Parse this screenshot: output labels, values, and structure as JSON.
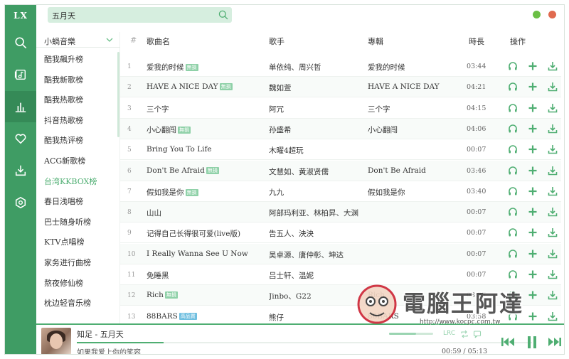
{
  "app": {
    "logo": "LX"
  },
  "colors": {
    "brand_green": "#3f9c64",
    "accent_green": "#4fae72",
    "min_dot": "#6bbf45",
    "close_dot": "#e06a4f"
  },
  "search": {
    "value": "五月天",
    "icon": "search-icon"
  },
  "nav": [
    {
      "icon": "search-icon",
      "active": false
    },
    {
      "icon": "music-list-icon",
      "active": false
    },
    {
      "icon": "leaderboard-icon",
      "active": true
    },
    {
      "icon": "heart-icon",
      "active": false
    },
    {
      "icon": "download-icon",
      "active": false
    },
    {
      "icon": "settings-icon",
      "active": false
    }
  ],
  "sidebar": {
    "source": "小蝸音樂",
    "items": [
      {
        "label": "酷我飆升榜"
      },
      {
        "label": "酷我新歌榜"
      },
      {
        "label": "酷我热歌榜"
      },
      {
        "label": "抖音热歌榜"
      },
      {
        "label": "酷我热评榜"
      },
      {
        "label": "ACG新歌榜"
      },
      {
        "label": "台湾KKBOX榜",
        "active": true
      },
      {
        "label": "春日浅唱榜"
      },
      {
        "label": "巴士随身听榜"
      },
      {
        "label": "KTV点唱榜"
      },
      {
        "label": "家务进行曲榜"
      },
      {
        "label": "熬夜修仙榜"
      },
      {
        "label": "枕边轻音乐榜"
      }
    ]
  },
  "table": {
    "headers": {
      "num": "#",
      "name": "歌曲名",
      "artist": "歌手",
      "album": "專輯",
      "duration": "時長",
      "actions": "操作"
    },
    "rows": [
      {
        "num": "1",
        "name": "爱我的时候",
        "badge": "無損",
        "artist": "单依纯、周兴哲",
        "album": "爱我的时候",
        "duration": "03:44"
      },
      {
        "num": "2",
        "name": "HAVE A NICE DAY",
        "badge": "無損",
        "artist": "魏如萱",
        "album": "HAVE A NICE DAY",
        "duration": "04:21"
      },
      {
        "num": "3",
        "name": "三个字",
        "badge": "",
        "artist": "阿冗",
        "album": "三个字",
        "duration": "04:15"
      },
      {
        "num": "4",
        "name": "小心翻闯",
        "badge": "無損",
        "artist": "孙盛希",
        "album": "小心翻闯",
        "duration": "04:06"
      },
      {
        "num": "5",
        "name": "Bring You To Life",
        "badge": "",
        "artist": "木曜4超玩",
        "album": "",
        "duration": "00:07"
      },
      {
        "num": "6",
        "name": "Don't Be Afraid",
        "badge": "無損",
        "artist": "文慧如、黄淑贤儒",
        "album": "Don't Be Afraid",
        "duration": "03:46"
      },
      {
        "num": "7",
        "name": "假如我是你",
        "badge": "無損",
        "artist": "九九",
        "album": "假如我是你",
        "duration": "03:40"
      },
      {
        "num": "8",
        "name": "山山",
        "badge": "",
        "artist": "阿部玛利亚、林柏昇、大渊",
        "album": "",
        "duration": "00:07"
      },
      {
        "num": "9",
        "name": "记得自己长得很可爱(live版)",
        "badge": "",
        "artist": "告五人、泱泱",
        "album": "",
        "duration": "00:07"
      },
      {
        "num": "10",
        "name": "I Really Wanna See U Now",
        "badge": "",
        "artist": "吴卓源、唐仲彰、坤达",
        "album": "",
        "duration": "00:07"
      },
      {
        "num": "11",
        "name": "免睡黑",
        "badge": "",
        "artist": "吕士轩、温妮",
        "album": "",
        "duration": "00:07"
      },
      {
        "num": "12",
        "name": "Rich",
        "badge": "無損",
        "artist": "Jinbo、G22",
        "album": "Rich",
        "duration": "03:27"
      },
      {
        "num": "13",
        "name": "88BARS",
        "badge": "高品質",
        "badge_type": "hq",
        "artist": "熊仔",
        "album": "88BARS",
        "duration": "03:58"
      }
    ]
  },
  "player": {
    "title": "知足 - 五月天",
    "lyric": "如果我爱上你的笑容",
    "current": "00:59",
    "separator": "/",
    "total": "05:13",
    "progress": 0.19,
    "volume": 0.62,
    "lrc_label": "LRC"
  },
  "watermark": {
    "text": "電腦王阿達",
    "url": "http://www.kocpc.com.tw"
  }
}
